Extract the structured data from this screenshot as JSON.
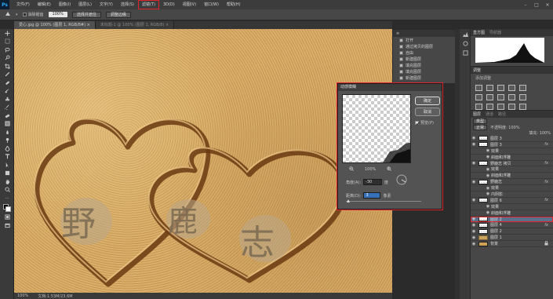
{
  "app": {
    "logo": "Ps"
  },
  "menu": {
    "items": [
      "文件(F)",
      "编辑(E)",
      "图像(I)",
      "图层(L)",
      "文字(Y)",
      "选择(S)",
      "滤镜(T)",
      "3D(D)",
      "视图(V)",
      "窗口(W)",
      "帮助(H)"
    ],
    "highlighted_index": 6
  },
  "window_controls": {
    "minimize": "–",
    "maximize": "□",
    "close": "✕"
  },
  "options_bar": {
    "checkbox_label": "消除锯齿",
    "field_value": "100%",
    "button1": "选择并遮住",
    "button2": "调整边缘"
  },
  "doc_tabs": [
    {
      "label": "爱心.jpg @ 100% (图层 1, RGB/8#) ×",
      "active": true
    },
    {
      "label": "未标题-1 @ 100% (图层 1, RGB/8) ×",
      "active": false
    }
  ],
  "status_bar": {
    "zoom": "100%",
    "doc": "文档:1.53M/23.6M"
  },
  "history_small": {
    "items": [
      "打开",
      "通过拷贝的图层",
      "自由",
      "新建图层",
      "填充图层",
      "填充图层",
      "新建图层"
    ]
  },
  "dialog": {
    "title": "动感模糊",
    "ok": "确定",
    "cancel": "取消",
    "preview_label": "预览(P)",
    "zoom": "100%",
    "angle_label": "角度(A):",
    "angle_value": "-30",
    "angle_unit": "度",
    "distance_label": "距离(D):",
    "distance_value": "3",
    "distance_unit": "像素"
  },
  "right_panels": {
    "histogram_tab": "直方图",
    "navigator_tab": "导航器",
    "adjustments_tab": "调整",
    "adjustments_heading": "添加调整",
    "layers_tabs": [
      "图层",
      "通道",
      "路径"
    ],
    "layer_kind": "类型",
    "blend_mode": "正常",
    "opacity": "不透明度: 100%",
    "fill": "填充: 100%"
  },
  "layers": [
    {
      "name": "图层 3",
      "type": "layer",
      "fx": false
    },
    {
      "name": "图层 3",
      "type": "layer",
      "fx": true
    },
    {
      "name": "效果",
      "type": "sub"
    },
    {
      "name": "斜面和浮雕",
      "type": "sub"
    },
    {
      "name": "野鹿志 拷贝",
      "type": "layer",
      "fx": true
    },
    {
      "name": "效果",
      "type": "sub"
    },
    {
      "name": "斜面和浮雕",
      "type": "sub"
    },
    {
      "name": "野鹿志",
      "type": "layer",
      "fx": true
    },
    {
      "name": "效果",
      "type": "sub"
    },
    {
      "name": "内阴影",
      "type": "sub"
    },
    {
      "name": "图层 6",
      "type": "layer",
      "fx": true
    },
    {
      "name": "效果",
      "type": "sub"
    },
    {
      "name": "斜面和浮雕",
      "type": "sub"
    },
    {
      "name": "图层 2",
      "type": "layer",
      "fx": false,
      "selected": true
    },
    {
      "name": "图层 4",
      "type": "layer",
      "fx": true
    },
    {
      "name": "图层 2",
      "type": "layer",
      "fx": false
    },
    {
      "name": "图层 1",
      "type": "folder",
      "fx": false
    },
    {
      "name": "背景",
      "type": "bg",
      "fx": false
    }
  ],
  "canvas": {
    "carved_chars": [
      "野",
      "鹿",
      "志"
    ]
  }
}
